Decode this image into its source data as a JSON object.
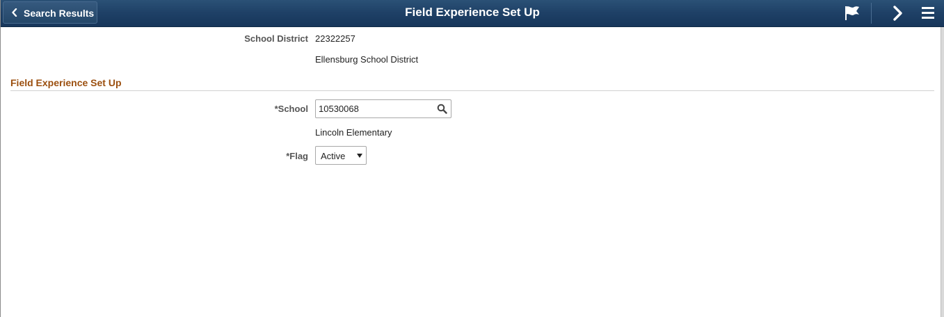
{
  "header": {
    "back_label": "Search Results",
    "title": "Field Experience Set Up",
    "icons": [
      "flag-icon",
      "chevron-right-icon",
      "menu-icon"
    ],
    "banner_color": "#1e4066"
  },
  "district": {
    "label": "School District",
    "value": "22322257",
    "description": "Ellensburg School District"
  },
  "section": {
    "title": "Field Experience Set Up",
    "title_color": "#9b4f0f"
  },
  "school": {
    "label": "*School",
    "value": "10530068",
    "description": "Lincoln Elementary",
    "lookup_icon": "search-icon"
  },
  "flag": {
    "label": "*Flag",
    "selected": "Active"
  }
}
